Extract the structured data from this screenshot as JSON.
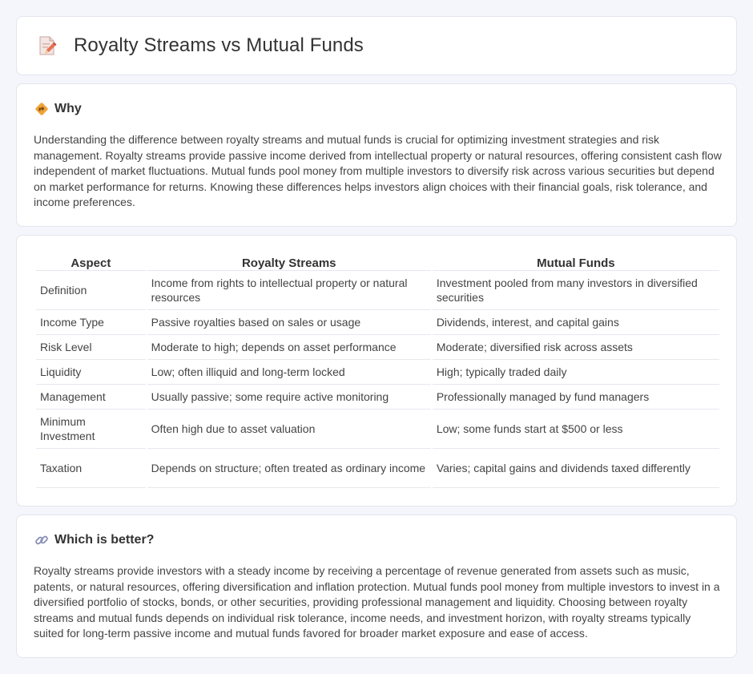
{
  "header": {
    "title": "Royalty Streams vs Mutual Funds",
    "icon": "document-edit-icon"
  },
  "why": {
    "icon": "diamond-directions-icon",
    "title": "Why",
    "text": "Understanding the difference between royalty streams and mutual funds is crucial for optimizing investment strategies and risk management. Royalty streams provide passive income derived from intellectual property or natural resources, offering consistent cash flow independent of market fluctuations. Mutual funds pool money from multiple investors to diversify risk across various securities but depend on market performance for returns. Knowing these differences helps investors align choices with their financial goals, risk tolerance, and income preferences."
  },
  "comparison": {
    "headers": [
      "Aspect",
      "Royalty Streams",
      "Mutual Funds"
    ],
    "rows": [
      [
        "Definition",
        "Income from rights to intellectual property or natural resources",
        "Investment pooled from many investors in diversified securities"
      ],
      [
        "Income Type",
        "Passive royalties based on sales or usage",
        "Dividends, interest, and capital gains"
      ],
      [
        "Risk Level",
        "Moderate to high; depends on asset performance",
        "Moderate; diversified risk across assets"
      ],
      [
        "Liquidity",
        "Low; often illiquid and long-term locked",
        "High; typically traded daily"
      ],
      [
        "Management",
        "Usually passive; some require active monitoring",
        "Professionally managed by fund managers"
      ],
      [
        "Minimum Investment",
        "Often high due to asset valuation",
        "Low; some funds start at $500 or less"
      ],
      [
        "Taxation",
        "Depends on structure; often treated as ordinary income",
        "Varies; capital gains and dividends taxed differently"
      ]
    ]
  },
  "better": {
    "icon": "link-icon",
    "title": "Which is better?",
    "text": "Royalty streams provide investors with a steady income by receiving a percentage of revenue generated from assets such as music, patents, or natural resources, offering diversification and inflation protection. Mutual funds pool money from multiple investors to invest in a diversified portfolio of stocks, bonds, or other securities, providing professional management and liquidity. Choosing between royalty streams and mutual funds depends on individual risk tolerance, income needs, and investment horizon, with royalty streams typically suited for long-term passive income and mutual funds favored for broader market exposure and ease of access."
  }
}
